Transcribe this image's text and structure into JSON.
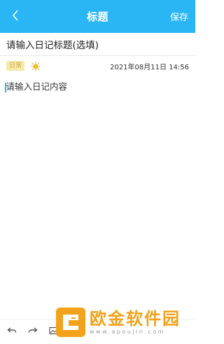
{
  "header": {
    "title": "标题",
    "save_label": "保存",
    "background": "#2ab6f4"
  },
  "editor": {
    "title_placeholder": "请输入日记标题(选填)",
    "category": "日常",
    "weather": "sun-icon",
    "date": "2021年08月11日 14:56",
    "content_placeholder": "请输入日记内容"
  },
  "toolbar": {
    "icons": [
      "undo-icon",
      "redo-icon",
      "image-icon"
    ]
  },
  "watermark": {
    "text": "欧金软件园",
    "url": "www.apoujin.com",
    "color": "#f2a21b"
  }
}
